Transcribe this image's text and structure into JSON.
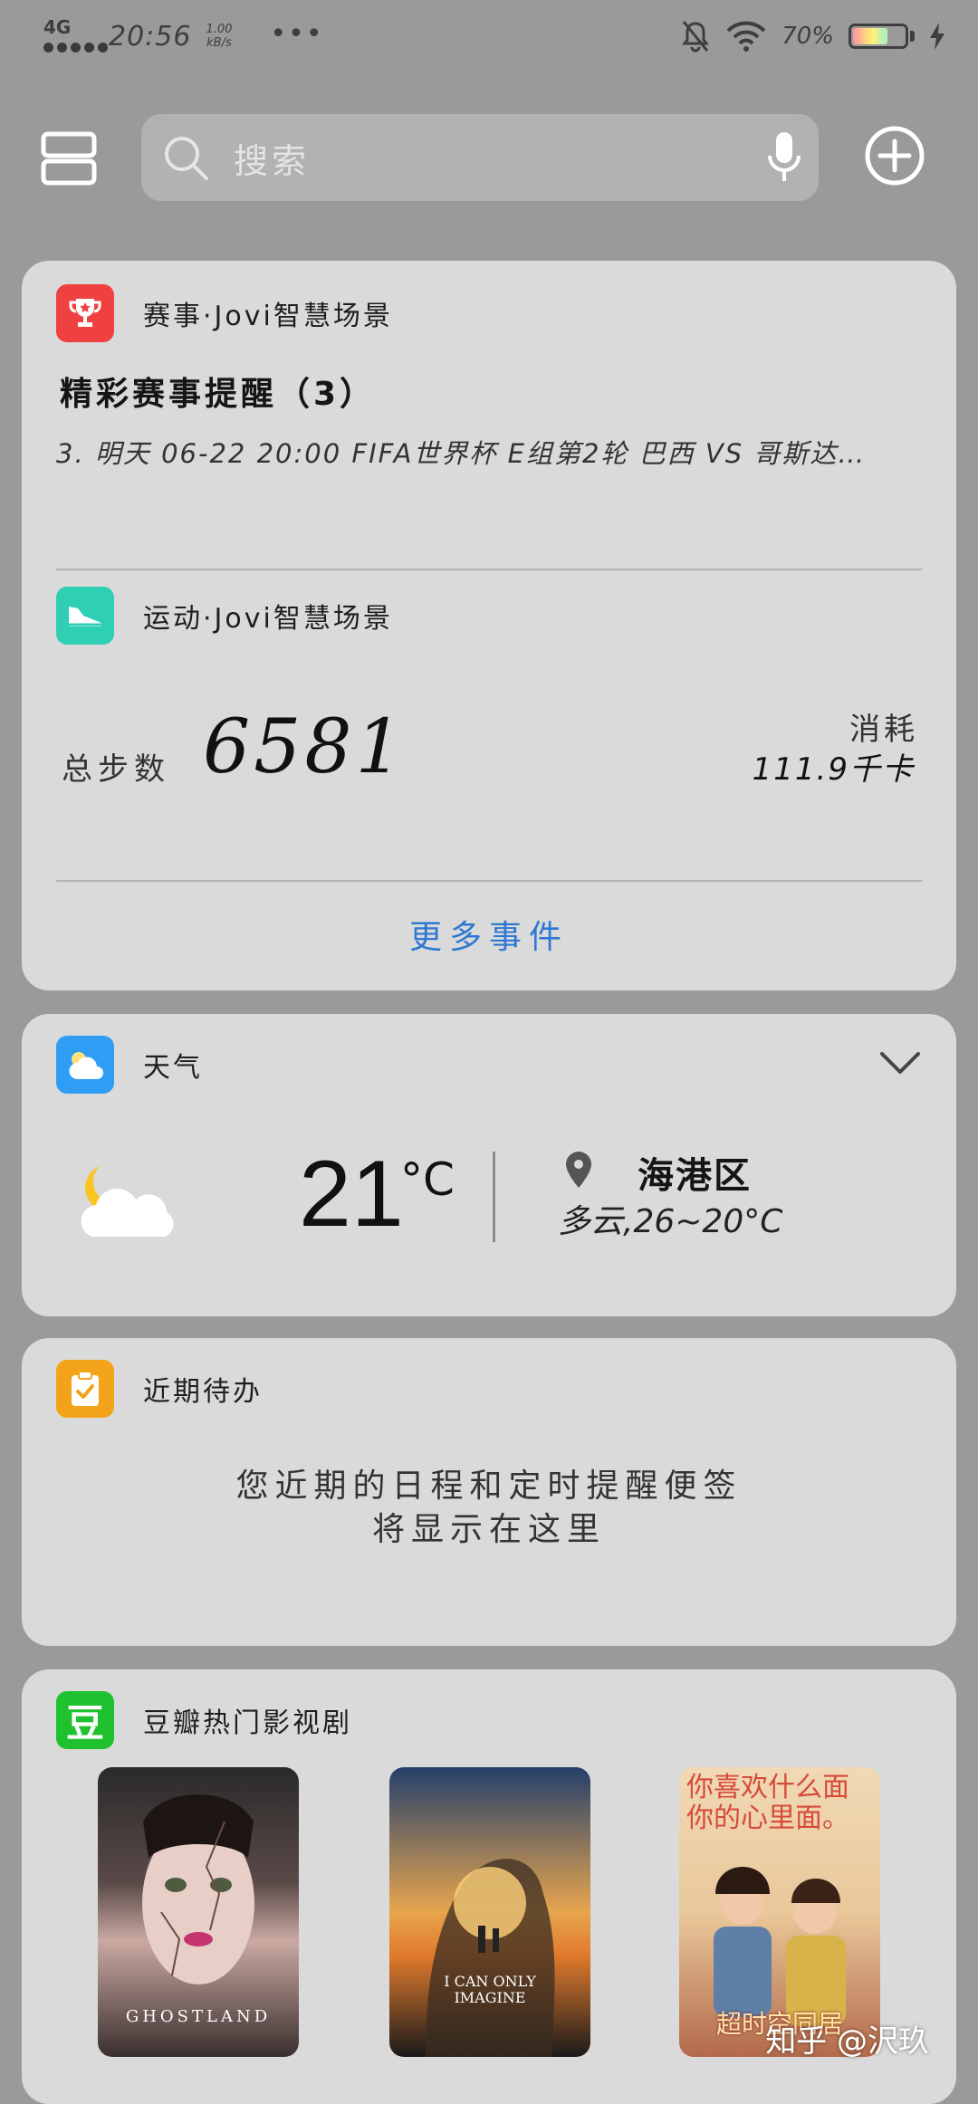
{
  "status_bar": {
    "network": "4G",
    "time": "20:56",
    "speed_value": "1.00",
    "speed_unit": "kB/s",
    "more": "•••",
    "battery_percent": "70%",
    "battery_level": 0.7
  },
  "top_bar": {
    "search_placeholder": "搜索"
  },
  "card_events": {
    "title": "赛事·Jovi智慧场景",
    "heading": "精彩赛事提醒（3）",
    "event": "3.  明天 06-22 20:00 FIFA世界杯 E组第2轮 巴西 VS 哥斯达…"
  },
  "card_sports": {
    "title": "运动·Jovi智慧场景",
    "steps_label": "总步数",
    "steps_value": "6581",
    "consume_label": "消耗",
    "consume_value": "111.9千卡",
    "more_events": "更多事件"
  },
  "card_weather": {
    "title": "天气",
    "temperature": "21",
    "unit": "°C",
    "location": "海港区",
    "description": "多云,26~20°C"
  },
  "card_todo": {
    "title": "近期待办",
    "line1": "您近期的日程和定时提醒便签",
    "line2": "将显示在这里"
  },
  "card_douban": {
    "title": "豆瓣热门影视剧",
    "icon_text": "豆",
    "posters": [
      {
        "title": "GHOSTLAND"
      },
      {
        "title": "I CAN ONLY IMAGINE"
      },
      {
        "title": "超时空同居"
      }
    ],
    "poster1_tagline": "你喜欢什么面 你的心里面。"
  },
  "watermark": "知乎 @沢玖",
  "colors": {
    "accent_blue": "#2e78d3",
    "events_icon": "#f04141",
    "sports_icon": "#2ecfb3",
    "weather_icon": "#2f9df4",
    "todo_icon": "#f3a31a",
    "douban_icon": "#1fc12e"
  },
  "icons": {
    "events": "trophy-icon",
    "sports": "sneaker-icon",
    "weather": "cloud-sun-icon",
    "todo": "clipboard-check-icon",
    "douban": "douban-icon"
  }
}
